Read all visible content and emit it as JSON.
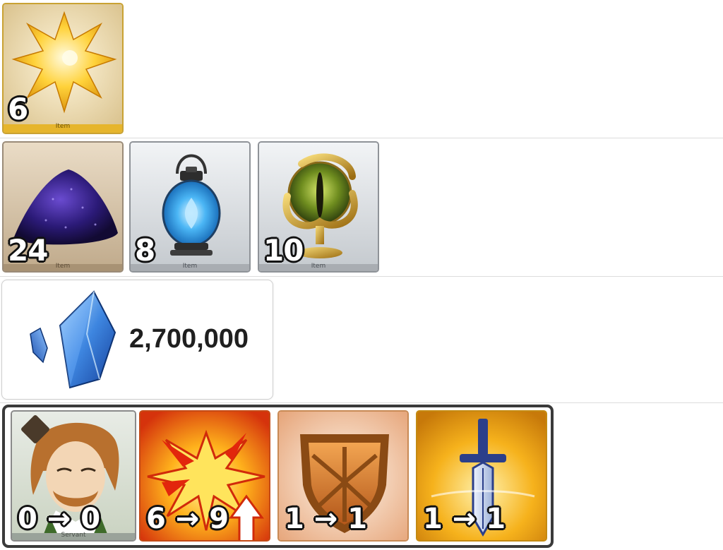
{
  "rows": {
    "row1": [
      {
        "name": "gold-star-item",
        "qty": "6",
        "strip": "Item"
      }
    ],
    "row2": [
      {
        "name": "purple-powder-item",
        "qty": "24",
        "strip": "Item"
      },
      {
        "name": "blue-lantern-item",
        "qty": "8",
        "strip": "Item"
      },
      {
        "name": "serpent-eye-item",
        "qty": "10",
        "strip": "Item"
      }
    ]
  },
  "qp": {
    "amount": "2,700,000",
    "icon": "blue-crystal-icon"
  },
  "upgrades": [
    {
      "name": "servant",
      "label": "0 → 0",
      "strip": "Servant"
    },
    {
      "name": "skill-1",
      "label": "6 → 9"
    },
    {
      "name": "skill-2",
      "label": "1 → 1"
    },
    {
      "name": "skill-3",
      "label": "1 → 1"
    }
  ],
  "colors": {
    "frame": "#3a3a3a",
    "separator": "#dcdcdc",
    "gold": "#e8b830",
    "blue": "#2a6cc8"
  }
}
